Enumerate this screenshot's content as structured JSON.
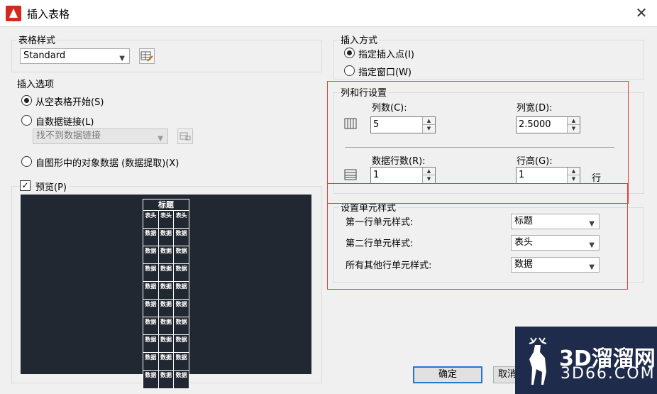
{
  "window": {
    "title": "插入表格"
  },
  "style_group": {
    "label": "表格样式",
    "selected": "Standard"
  },
  "insert_options": {
    "label": "插入选项",
    "empty": "从空表格开始(S)",
    "datalink": "自数据链接(L)",
    "datalink_value": "找不到数据链接",
    "object_data": "自图形中的对象数据 (数据提取)(X)"
  },
  "preview": {
    "label": "预览(P)",
    "checked": "✓",
    "table": {
      "title": "标题",
      "header": [
        "表头",
        "表头",
        "表头"
      ],
      "cell": "数据"
    }
  },
  "insert_method": {
    "label": "插入方式",
    "point": "指定插入点(I)",
    "window": "指定窗口(W)"
  },
  "col_row": {
    "label": "列和行设置",
    "cols_label": "列数(C):",
    "cols_value": "5",
    "width_label": "列宽(D):",
    "width_value": "2.5000",
    "rows_label": "数据行数(R):",
    "rows_value": "1",
    "height_label": "行高(G):",
    "height_value": "1",
    "height_unit": "行"
  },
  "cell_style": {
    "label": "设置单元样式",
    "first_label": "第一行单元样式:",
    "first_value": "标题",
    "second_label": "第二行单元样式:",
    "second_value": "表头",
    "other_label": "所有其他行单元样式:",
    "other_value": "数据"
  },
  "buttons": {
    "ok": "确定",
    "cancel": "取消"
  },
  "watermark": {
    "brand": "3D溜溜网",
    "site": "3D66.COM"
  },
  "colors": {
    "highlight": "#e04040",
    "preview_bg": "#222831"
  }
}
